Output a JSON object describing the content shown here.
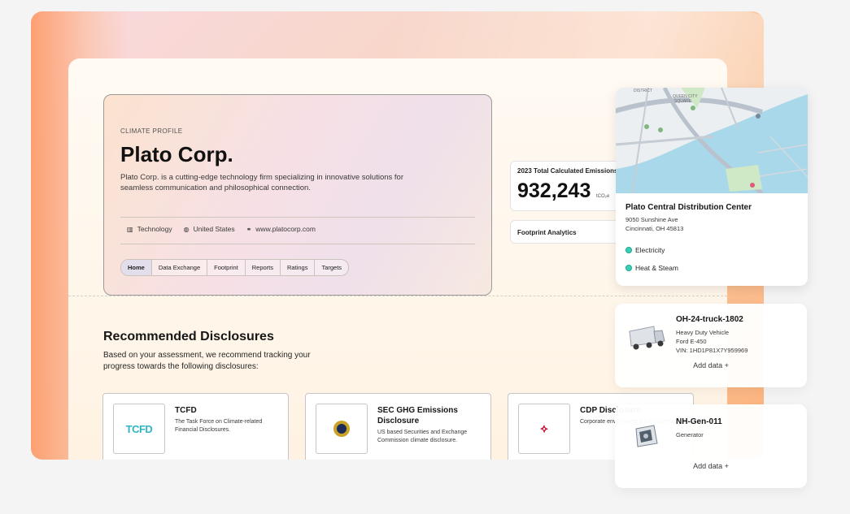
{
  "profile": {
    "eyebrow": "CLIMATE PROFILE",
    "company": "Plato Corp.",
    "description": "Plato Corp. is a cutting-edge technology firm specializing in innovative solutions for seamless communication and philosophical connection.",
    "meta": [
      {
        "icon": "building-icon",
        "label": "Technology"
      },
      {
        "icon": "globe-icon",
        "label": "United States"
      },
      {
        "icon": "link-icon",
        "label": "www.platocorp.com"
      }
    ],
    "tabs": [
      "Home",
      "Data Exchange",
      "Footprint",
      "Reports",
      "Ratings",
      "Targets"
    ],
    "active_tab": "Home"
  },
  "stats": {
    "label": "2023 Total Calculated Emissions",
    "value": "932,243",
    "unit": "tCO₂e",
    "footprint_link": "Footprint Analytics"
  },
  "recommended": {
    "title": "Recommended Disclosures",
    "description": "Based on your assessment, we recommend tracking your progress towards the following disclosures:",
    "cards": [
      {
        "logo_text": "TCFD",
        "title": "TCFD",
        "description": "The Task Force on Climate-related Financial Disclosures."
      },
      {
        "title": "SEC GHG Emissions Disclosure",
        "description": "US based Securities and Exchange Commission climate disclosure."
      },
      {
        "title": "CDP Disclosure",
        "description": "Corporate environmental transparency"
      }
    ]
  },
  "location": {
    "name": "Plato Central Distribution Center",
    "address_line1": "9050 Sunshine Ave",
    "address_line2": "Cincinnati, OH 45813",
    "sources": [
      "Electricity",
      "Heat & Steam"
    ],
    "map_labels": [
      "DISTRICT",
      "QUEEN CITY",
      "SQUARE"
    ],
    "accent": "#3ccfb8"
  },
  "assets": [
    {
      "name": "OH-24-truck-1802",
      "type": "Heavy Duty Vehicle",
      "model": "Ford E-450",
      "vin": "VIN: 1HD1P81X7Y959969",
      "add_label": "Add data +"
    },
    {
      "name": "NH-Gen-011",
      "type": "Generator",
      "add_label": "Add data +"
    }
  ]
}
